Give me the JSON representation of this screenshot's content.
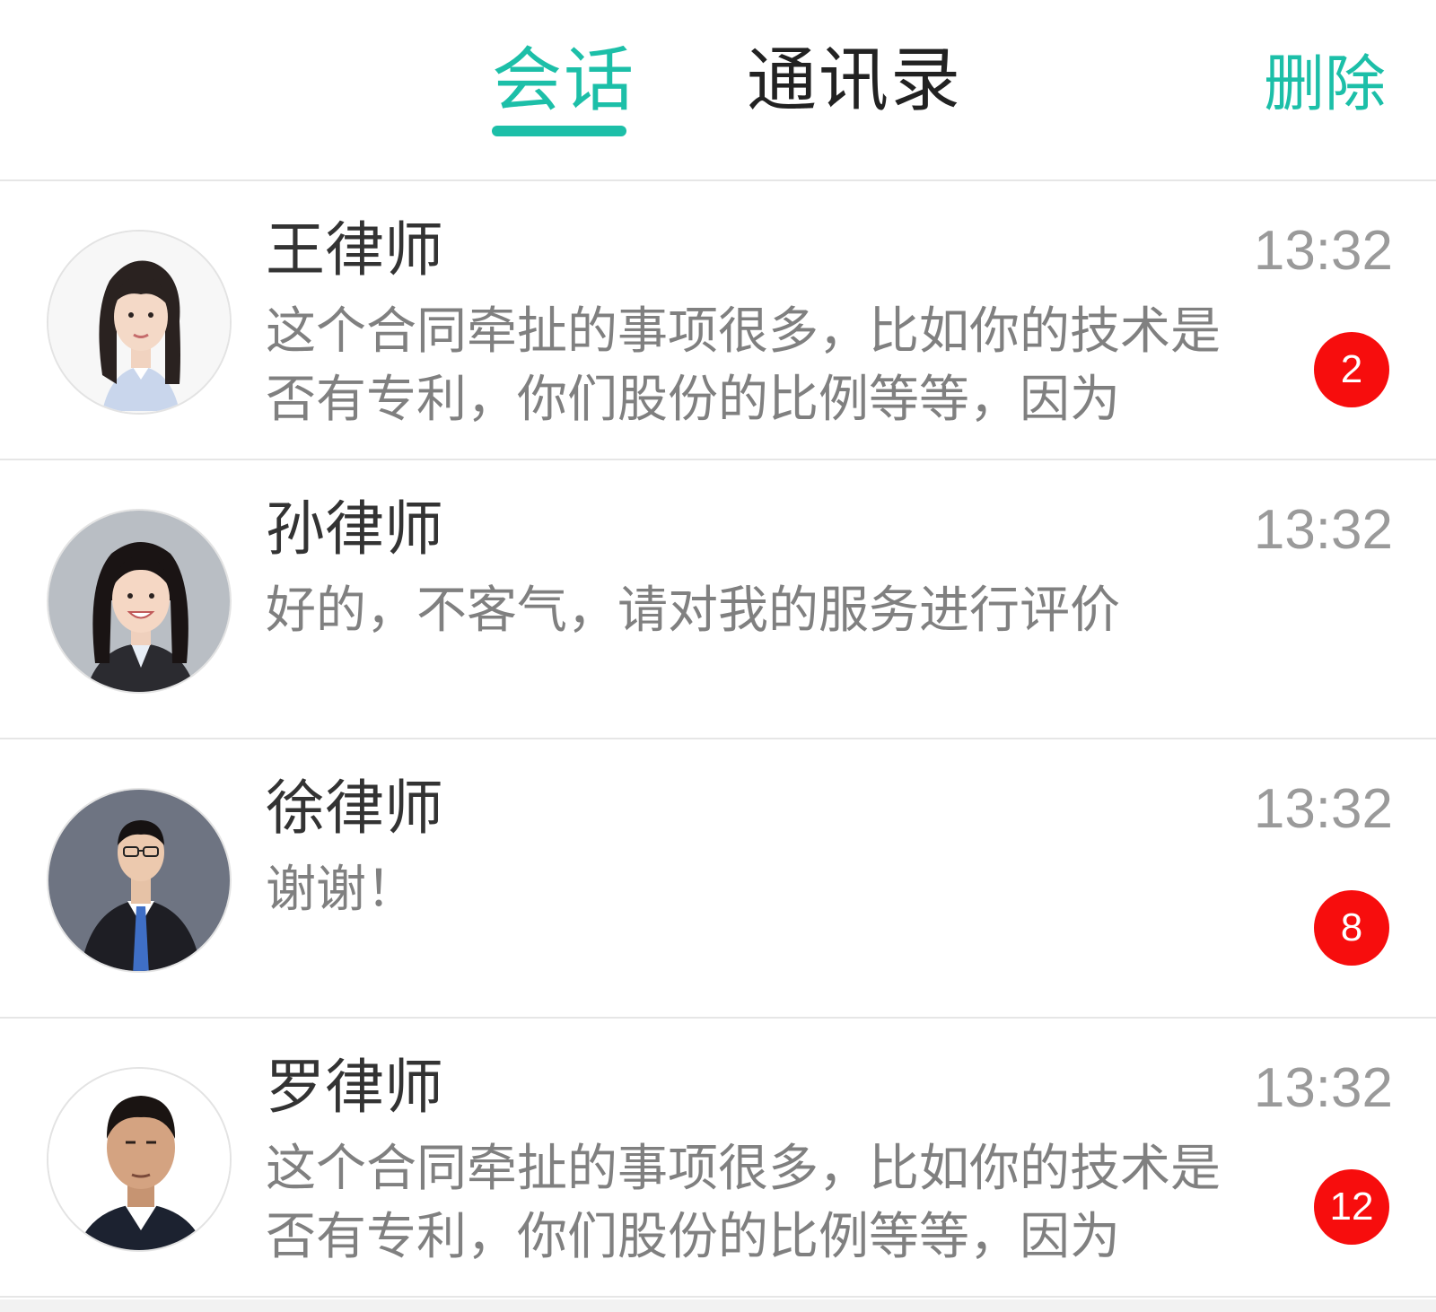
{
  "header": {
    "tabs": [
      {
        "label": "会话",
        "active": true
      },
      {
        "label": "通讯录",
        "active": false
      }
    ],
    "delete_label": "删除",
    "accent_color": "#1cbfa8"
  },
  "conversations": [
    {
      "name": "王律师",
      "time": "13:32",
      "preview": "这个合同牵扯的事项很多，比如你的技术是否有专利，你们股份的比例等等，因为",
      "unread": "2",
      "avatar": "female-lawyer-avatar"
    },
    {
      "name": "孙律师",
      "time": "13:32",
      "preview": "好的，不客气，请对我的服务进行评价",
      "unread": null,
      "avatar": "female-lawyer-avatar"
    },
    {
      "name": "徐律师",
      "time": "13:32",
      "preview": "谢谢！",
      "unread": "8",
      "avatar": "male-lawyer-avatar"
    },
    {
      "name": "罗律师",
      "time": "13:32",
      "preview": "这个合同牵扯的事项很多，比如你的技术是否有专利，你们股份的比例等等，因为",
      "unread": "12",
      "avatar": "male-lawyer-avatar"
    }
  ],
  "badge_color": "#f70d0d"
}
